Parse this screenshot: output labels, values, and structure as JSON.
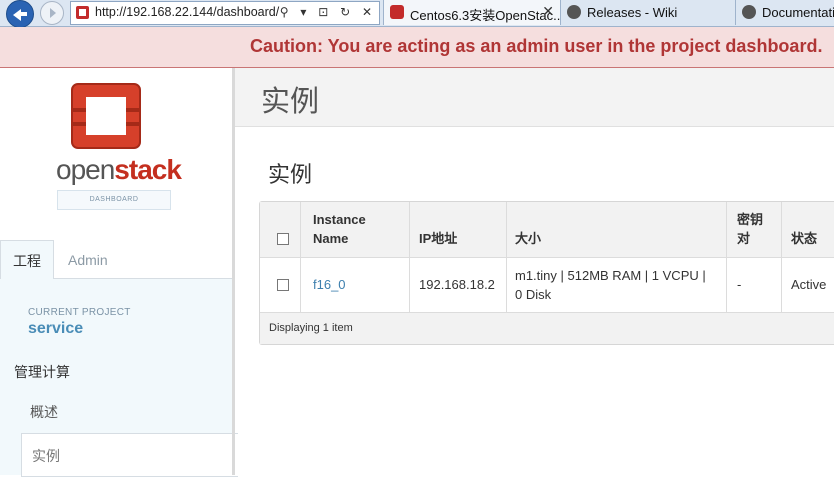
{
  "browser": {
    "url": "http://192.168.22.144/dashboard/",
    "url_icons": "⚲ ▾ ⊡ ↻ ✕",
    "tabs": [
      {
        "label": "Centos6.3安装OpenStac...",
        "close": "✕"
      },
      {
        "label": "Releases - Wiki"
      },
      {
        "label": "Documentatio"
      }
    ]
  },
  "caution": "Caution: You are acting as an admin user in the project dashboard.",
  "sidebar": {
    "brand_prefix": "open",
    "brand_suffix": "stack",
    "brand_sub": "DASHBOARD",
    "tabs": [
      {
        "label": "工程"
      },
      {
        "label": "Admin"
      }
    ],
    "current_project_label": "CURRENT PROJECT",
    "current_project": "service",
    "nav_heading": "管理计算",
    "nav_items": [
      {
        "label": "概述"
      },
      {
        "label": "实例"
      }
    ]
  },
  "page": {
    "header_title": "实例",
    "section_title": "实例"
  },
  "table": {
    "columns": {
      "instance_name_1": "Instance",
      "instance_name_2": "Name",
      "ip": "IP地址",
      "size": "大小",
      "keypair_1": "密钥",
      "keypair_2": "对",
      "status": "状态"
    },
    "rows": [
      {
        "name": "f16_0",
        "ip": "192.168.18.2",
        "size_1": "m1.tiny | 512MB RAM | 1 VCPU |",
        "size_2": "0 Disk",
        "keypair": "-",
        "status": "Active"
      }
    ],
    "footer": "Displaying 1 item"
  },
  "colors": {
    "caution_bg": "#f5dede",
    "caution_text": "#b03636",
    "link": "#3d7fae",
    "brand_red": "#c42f1f"
  }
}
